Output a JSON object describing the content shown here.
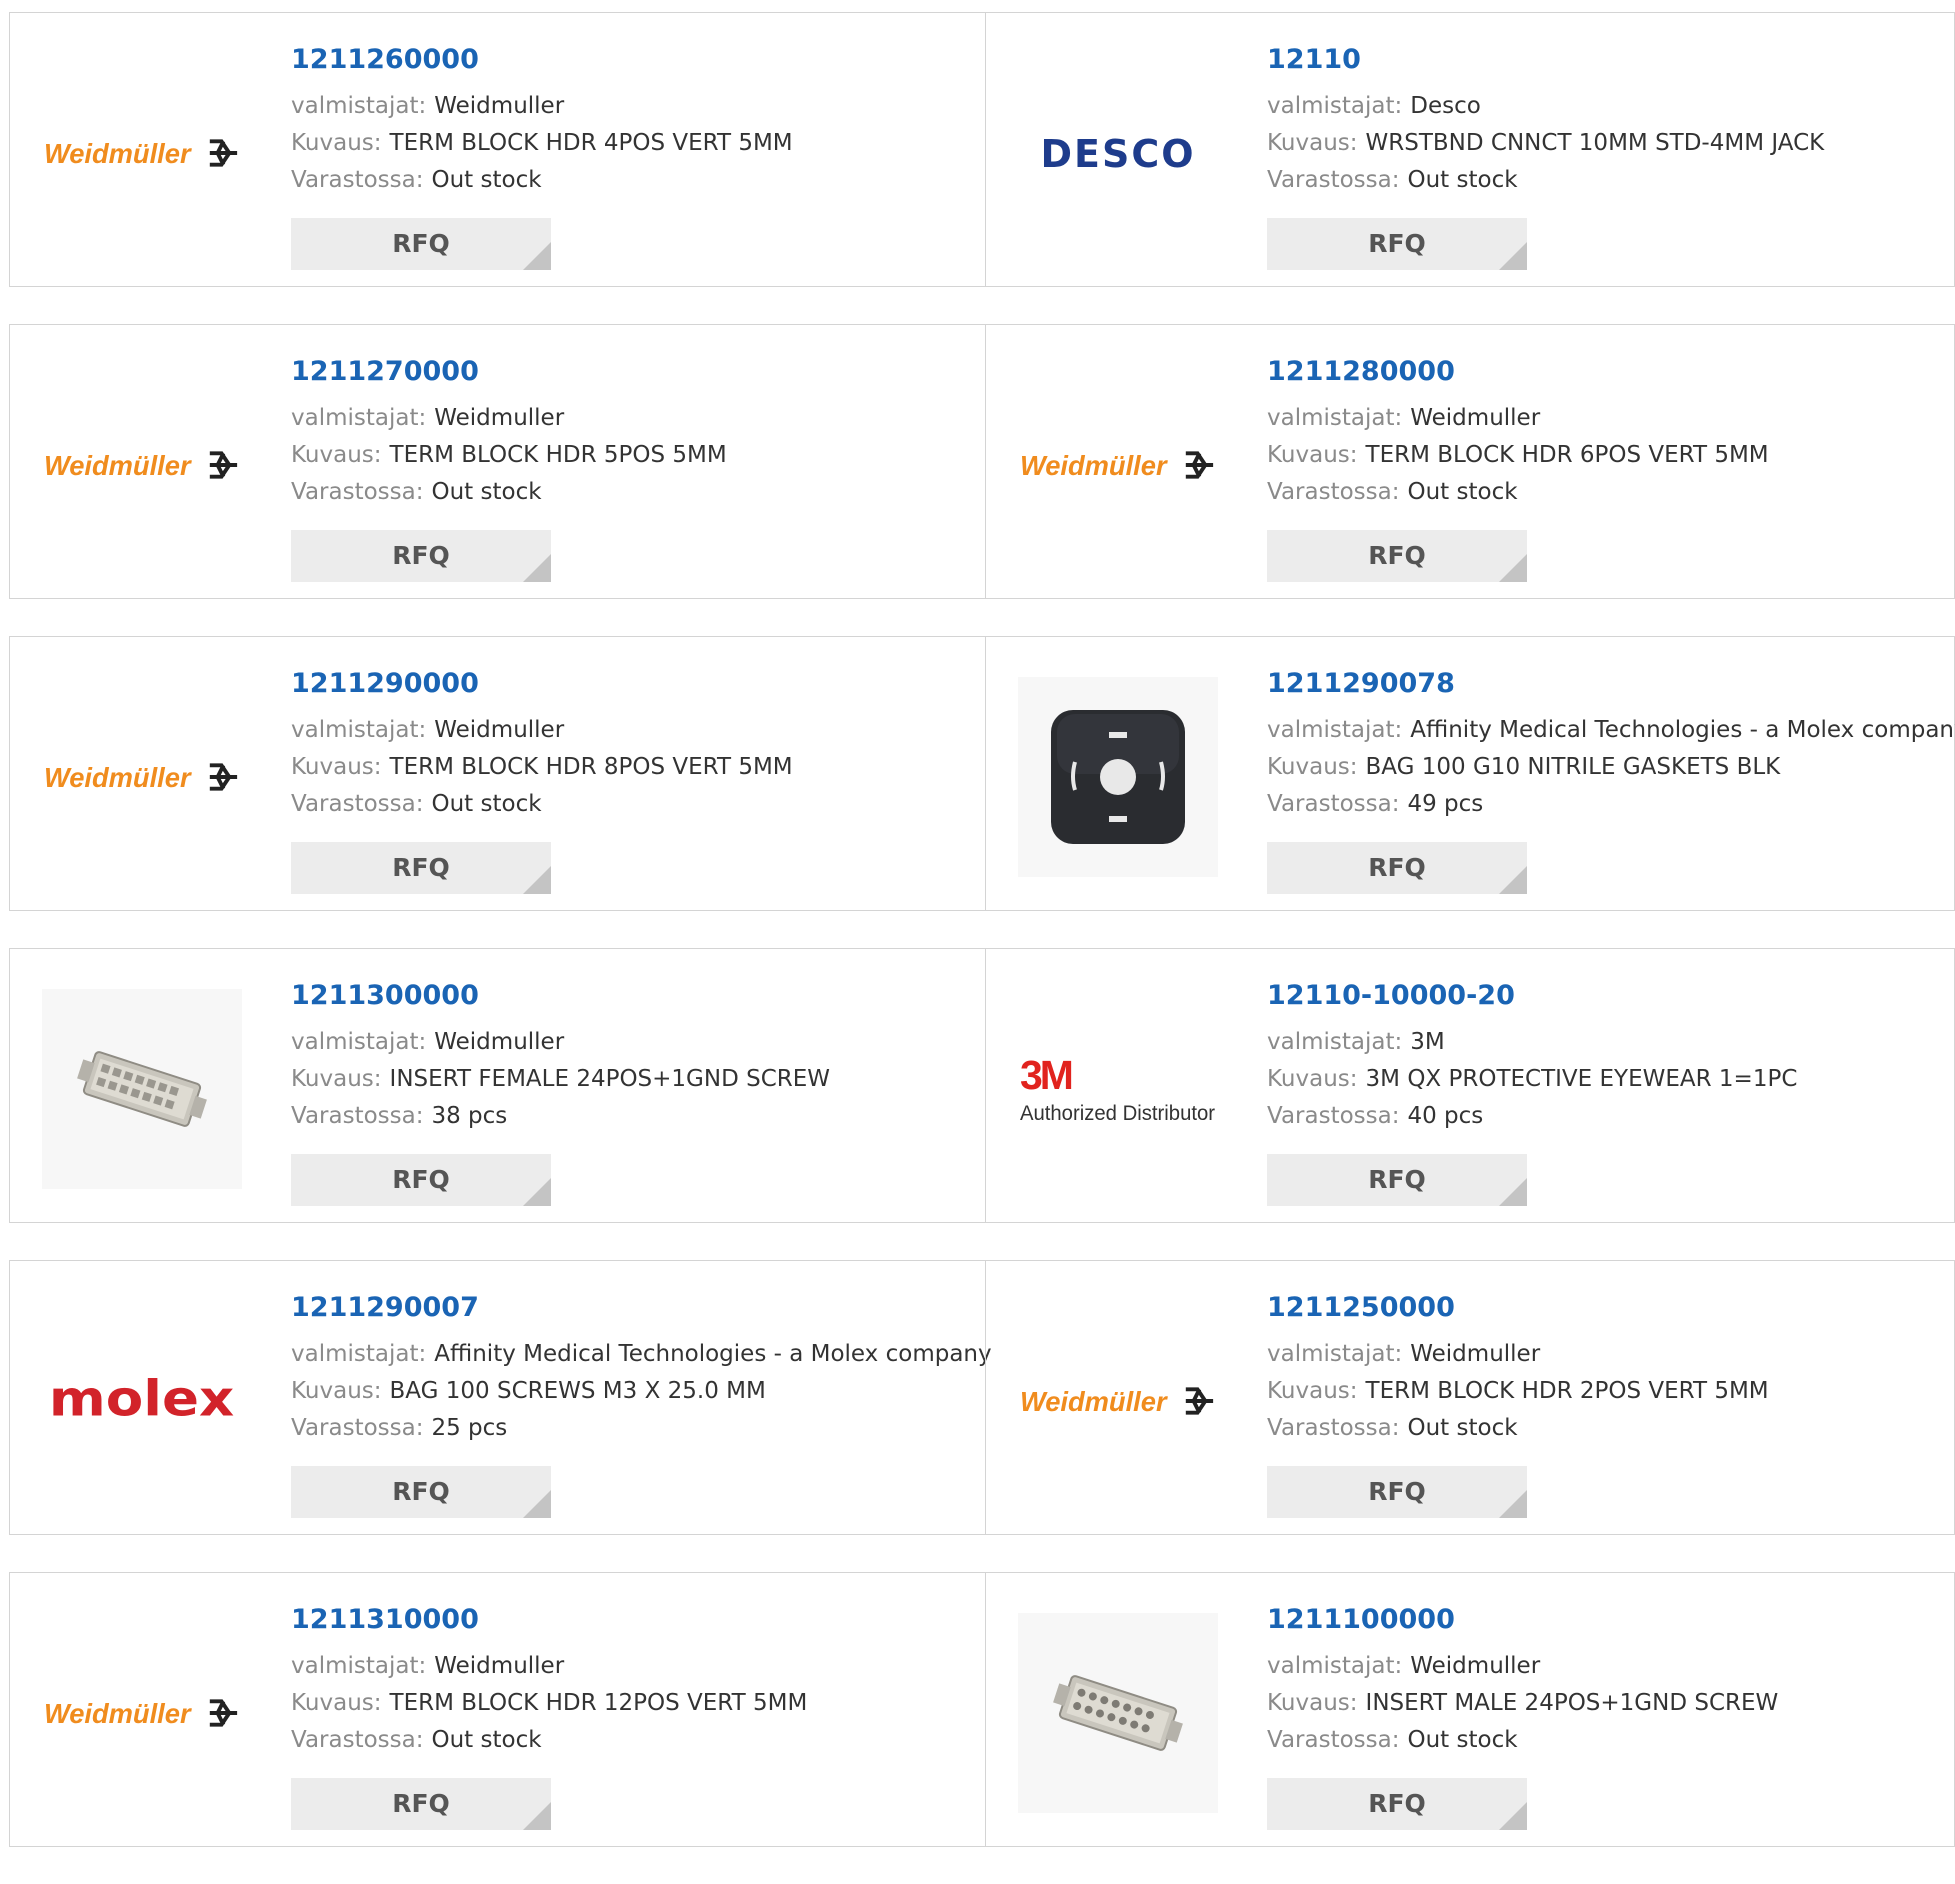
{
  "labels": {
    "manufacturer": "valmistajat:",
    "description": "Kuvaus:",
    "stock": "Varastossa:",
    "rfq": "RFQ"
  },
  "products": [
    {
      "part": "1211260000",
      "manufacturer": "Weidmuller",
      "description": "TERM BLOCK HDR 4POS VERT 5MM",
      "stock": "Out stock",
      "logo": "weidmuller-logo"
    },
    {
      "part": "12110",
      "manufacturer": "Desco",
      "description": "WRSTBND CNNCT 10MM STD-4MM JACK",
      "stock": "Out stock",
      "logo": "desco-logo"
    },
    {
      "part": "1211270000",
      "manufacturer": "Weidmuller",
      "description": "TERM BLOCK HDR 5POS 5MM",
      "stock": "Out stock",
      "logo": "weidmuller-logo"
    },
    {
      "part": "1211280000",
      "manufacturer": "Weidmuller",
      "description": "TERM BLOCK HDR 6POS VERT 5MM",
      "stock": "Out stock",
      "logo": "weidmuller-logo"
    },
    {
      "part": "1211290000",
      "manufacturer": "Weidmuller",
      "description": "TERM BLOCK HDR 8POS VERT 5MM",
      "stock": "Out stock",
      "logo": "weidmuller-logo"
    },
    {
      "part": "1211290078",
      "manufacturer": "Affinity Medical Technologies - a Molex company",
      "description": "BAG 100 G10 NITRILE GASKETS BLK",
      "stock": "49 pcs",
      "logo": "gasket-photo"
    },
    {
      "part": "1211300000",
      "manufacturer": "Weidmuller",
      "description": "INSERT FEMALE 24POS+1GND SCREW",
      "stock": "38 pcs",
      "logo": "connector-insert-photo"
    },
    {
      "part": "12110-10000-20",
      "manufacturer": "3M",
      "description": "3M QX PROTECTIVE EYEWEAR 1=1PC",
      "stock": "40 pcs",
      "logo": "3m-logo"
    },
    {
      "part": "1211290007",
      "manufacturer": "Affinity Medical Technologies - a Molex company",
      "description": "BAG 100 SCREWS M3 X 25.0 MM",
      "stock": "25 pcs",
      "logo": "molex-logo"
    },
    {
      "part": "1211250000",
      "manufacturer": "Weidmuller",
      "description": "TERM BLOCK HDR 2POS VERT 5MM",
      "stock": "Out stock",
      "logo": "weidmuller-logo"
    },
    {
      "part": "1211310000",
      "manufacturer": "Weidmuller",
      "description": "TERM BLOCK HDR 12POS VERT 5MM",
      "stock": "Out stock",
      "logo": "weidmuller-logo"
    },
    {
      "part": "1211100000",
      "manufacturer": "Weidmuller",
      "description": "INSERT MALE 24POS+1GND SCREW",
      "stock": "Out stock",
      "logo": "connector-insert-photo"
    }
  ],
  "logo_text": {
    "weidmuller": "Weidmüller",
    "desco": "DESCO",
    "molex": "molex",
    "three_m": "3M",
    "three_m_sub": "Authorized Distributor"
  },
  "colors": {
    "link": "#1a64b4",
    "weidmuller": "#f08c1e",
    "desco": "#1e3c8c",
    "molex": "#d2232a",
    "three_m": "#e1231e"
  }
}
